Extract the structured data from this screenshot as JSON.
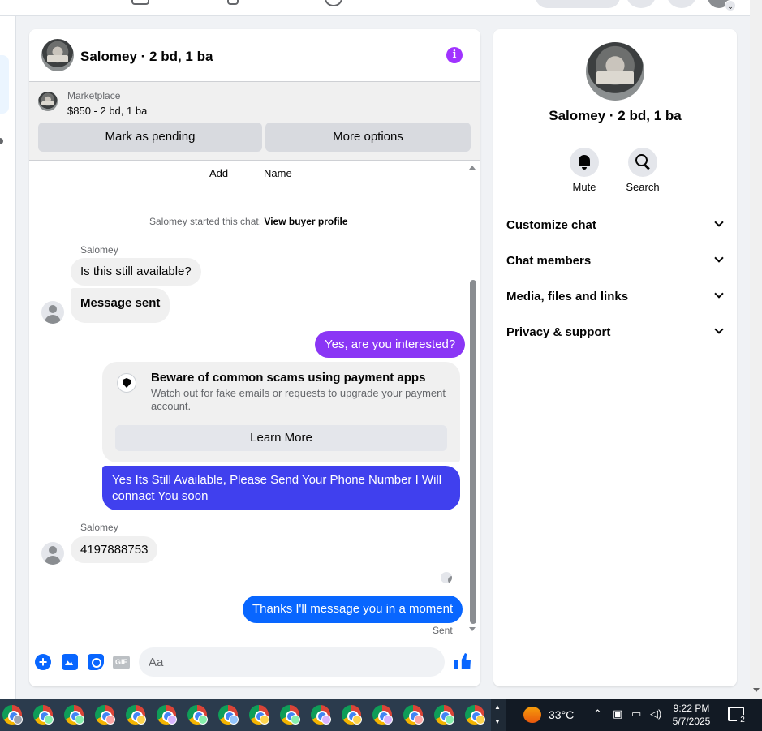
{
  "chat": {
    "title": "Salomey · 2 bd, 1 ba",
    "marketplace": {
      "label": "Marketplace",
      "price_line": "$850 - 2 bd, 1 ba",
      "pending_button": "Mark as pending",
      "options_button": "More options"
    },
    "partial_labels": [
      "Add",
      "Name"
    ],
    "system": {
      "text": "Salomey started this chat.",
      "link": "View buyer profile"
    },
    "messages": [
      {
        "from": "Salomey",
        "sender_label": "Salomey",
        "text": "Is this still available?"
      },
      {
        "from": "Salomey",
        "text": "Message sent"
      },
      {
        "from": "me",
        "text": "Yes, are you interested?"
      },
      {
        "from": "me",
        "text": "Yes Its Still Available, Please Send Your Phone Number I Will connact You soon"
      },
      {
        "from": "Salomey",
        "sender_label": "Salomey",
        "text": "4197888753"
      },
      {
        "from": "me",
        "text": "Thanks I'll message you in a moment"
      }
    ],
    "scam_warning": {
      "title": "Beware of common scams using payment apps",
      "body": "Watch out for fake emails or requests to upgrade your payment account.",
      "button": "Learn More"
    },
    "status": "Sent",
    "composer": {
      "placeholder": "Aa",
      "gif_label": "GIF",
      "plus_label": "+"
    }
  },
  "info_panel": {
    "name": "Salomey · 2 bd, 1 ba",
    "actions": [
      "Mute",
      "Search"
    ],
    "sections": [
      "Customize chat",
      "Chat members",
      "Media, files and links",
      "Privacy & support"
    ]
  },
  "taskbar": {
    "temperature": "33°C",
    "time": "9:22 PM",
    "date": "5/7/2025",
    "notification_count": "2",
    "app_icons": [
      "chrome-icon",
      "chrome-icon",
      "chrome-icon",
      "chrome-icon",
      "chrome-icon",
      "chrome-icon",
      "chrome-icon",
      "chrome-icon",
      "chrome-icon",
      "chrome-icon",
      "chrome-icon",
      "chrome-icon",
      "chrome-icon",
      "chrome-icon",
      "chrome-icon",
      "chrome-icon"
    ]
  },
  "colors": {
    "outgoing_purple": "#8a36f5",
    "outgoing_blue_purple": "#4040ee",
    "outgoing_blue": "#0866ff",
    "info_accent": "#a033ff"
  }
}
